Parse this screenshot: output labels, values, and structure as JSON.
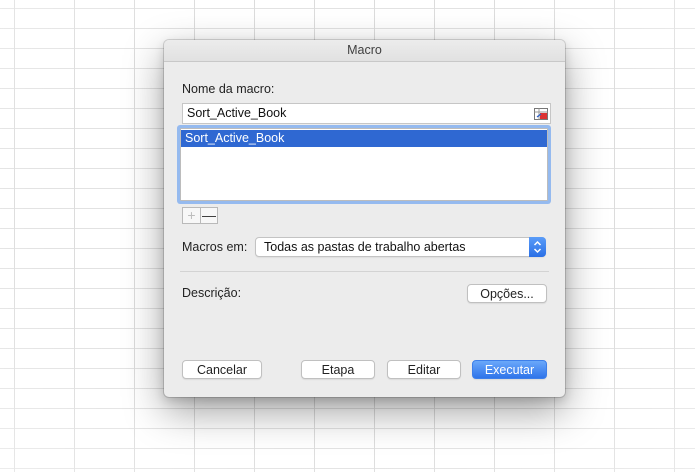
{
  "dialog": {
    "title": "Macro",
    "name_label": "Nome da macro:",
    "name_value": "Sort_Active_Book",
    "macros": [
      {
        "name": "Sort_Active_Book",
        "selected": true
      }
    ],
    "add_symbol": "+",
    "remove_symbol": "—",
    "macros_in_label": "Macros em:",
    "macros_in_value": "Todas as pastas de trabalho abertas",
    "description_label": "Descrição:",
    "options_label": "Opções...",
    "cancel_label": "Cancelar",
    "step_label": "Etapa",
    "edit_label": "Editar",
    "run_label": "Executar"
  },
  "colors": {
    "selection": "#2f68d2",
    "primary_button": "#2f74ea",
    "dialog_bg": "#ececec"
  },
  "icons": {
    "reference": "cell-reference-icon",
    "stepper": "select-stepper-icon"
  }
}
